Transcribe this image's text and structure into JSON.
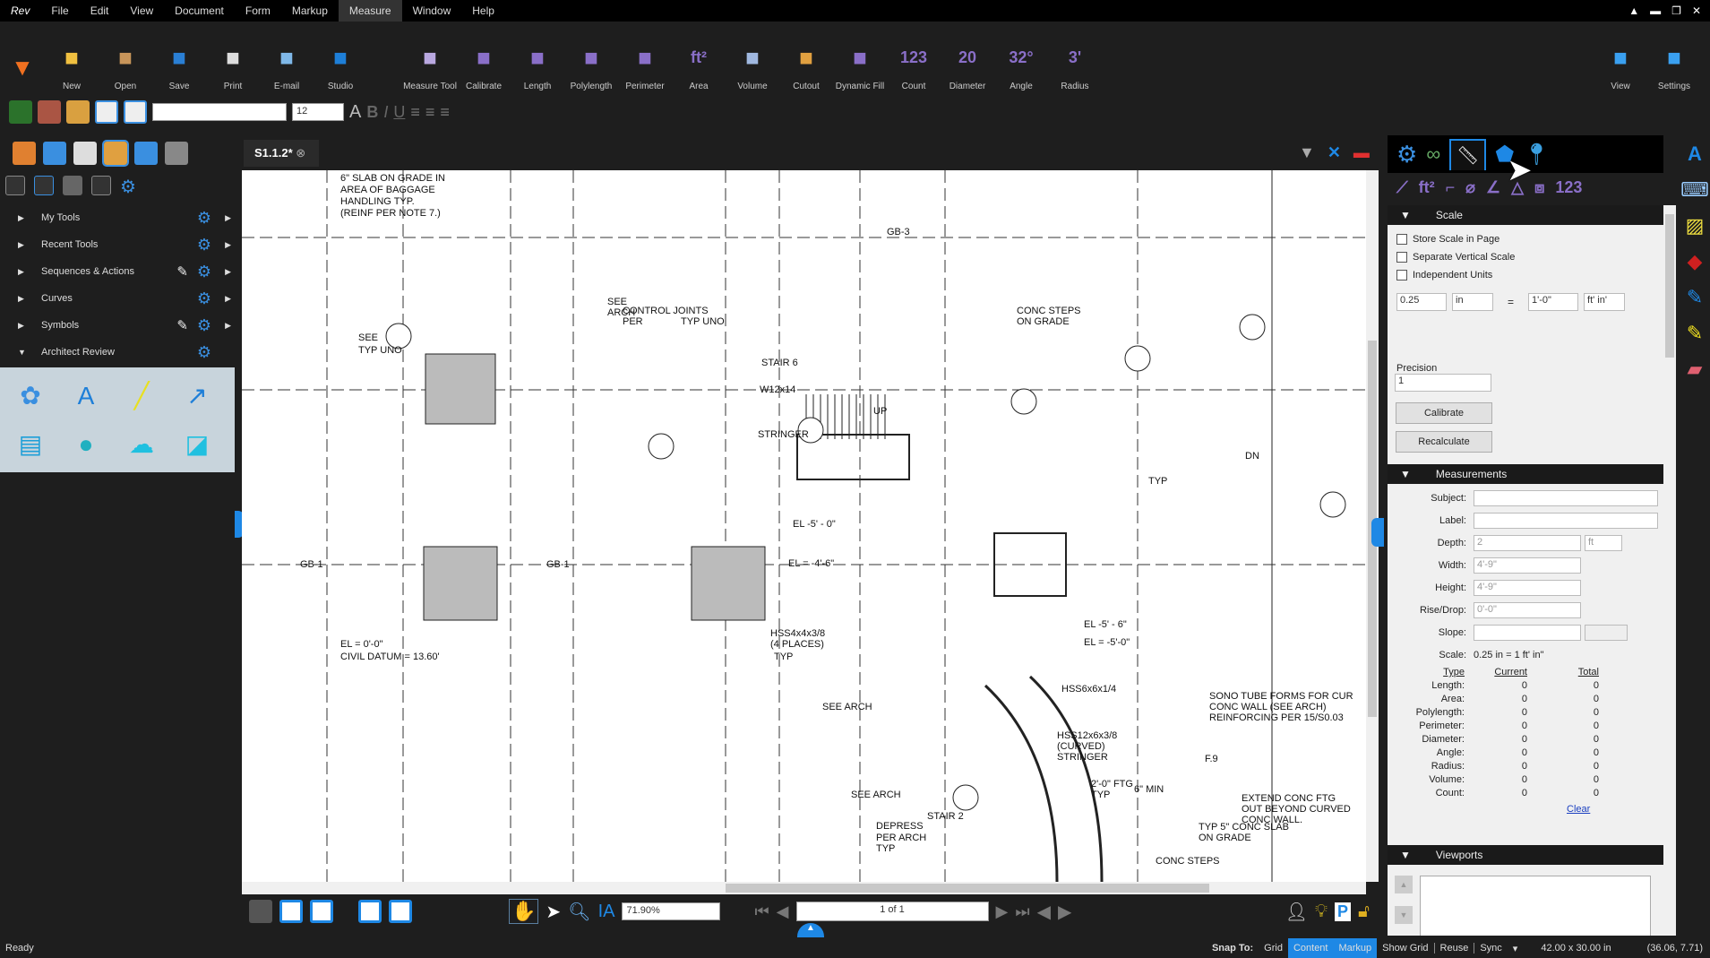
{
  "app": {
    "logo": "Rev",
    "window_controls": [
      "minimize",
      "restore",
      "close"
    ]
  },
  "menu": [
    "File",
    "Edit",
    "View",
    "Document",
    "Form",
    "Markup",
    "Measure",
    "Window",
    "Help"
  ],
  "menu_active": "Measure",
  "ribbon": [
    {
      "label": "New",
      "icon": "new-document-icon",
      "color": "#f0c040"
    },
    {
      "label": "Open",
      "icon": "open-folder-icon",
      "color": "#c8955a"
    },
    {
      "label": "Save",
      "icon": "save-disk-icon",
      "color": "#2a7fd4"
    },
    {
      "label": "Print",
      "icon": "printer-icon",
      "color": "#ddd"
    },
    {
      "label": "E-mail",
      "icon": "email-icon",
      "color": "#7fb8e8"
    },
    {
      "label": "Studio",
      "icon": "studio-icon",
      "color": "#1e7fd8"
    },
    {
      "label": "Measure Tool",
      "icon": "ruler-icon",
      "color": "#b9a8e0"
    },
    {
      "label": "Calibrate",
      "icon": "calibrate-icon",
      "color": "#8a6fc8"
    },
    {
      "label": "Length",
      "icon": "length-icon",
      "color": "#8a6fc8"
    },
    {
      "label": "Polylength",
      "icon": "polylength-icon",
      "color": "#8a6fc8"
    },
    {
      "label": "Perimeter",
      "icon": "perimeter-icon",
      "color": "#8a6fc8"
    },
    {
      "label": "Area",
      "icon": "area-icon",
      "glyph": "ft²",
      "color": "#8a6fc8"
    },
    {
      "label": "Volume",
      "icon": "volume-cube-icon",
      "color": "#a0b8e0"
    },
    {
      "label": "Cutout",
      "icon": "cutout-icon",
      "color": "#e0a040"
    },
    {
      "label": "Dynamic Fill",
      "icon": "dynamic-fill-icon",
      "color": "#8a6fc8"
    },
    {
      "label": "Count",
      "icon": "count-icon",
      "glyph": "123",
      "color": "#8a6fc8"
    },
    {
      "label": "Diameter",
      "icon": "diameter-icon",
      "glyph": "20",
      "color": "#8a6fc8"
    },
    {
      "label": "Angle",
      "icon": "angle-icon",
      "glyph": "32°",
      "color": "#8a6fc8"
    },
    {
      "label": "Radius",
      "icon": "radius-icon",
      "glyph": "3'",
      "color": "#8a6fc8"
    }
  ],
  "ribbon_right": [
    {
      "label": "View",
      "icon": "monitor-icon"
    },
    {
      "label": "Settings",
      "icon": "settings-logo-icon"
    }
  ],
  "format_toolbar": {
    "font_value": "",
    "size_value": "12"
  },
  "left_panel": {
    "items": [
      {
        "label": "My Tools",
        "expanded": false,
        "edit": false
      },
      {
        "label": "Recent Tools",
        "expanded": false,
        "edit": false
      },
      {
        "label": "Sequences & Actions",
        "expanded": false,
        "edit": true
      },
      {
        "label": "Curves",
        "expanded": false,
        "edit": false
      },
      {
        "label": "Symbols",
        "expanded": false,
        "edit": true
      },
      {
        "label": "Architect Review",
        "expanded": true,
        "edit": false
      }
    ]
  },
  "document_tab": {
    "label": "S1.1.2*"
  },
  "drawing_labels": [
    "6\" SLAB ON GRADE IN",
    "AREA OF BAGGAGE",
    "HANDLING TYP.",
    "(REINF PER NOTE 7.)",
    "CONTROL JOINTS",
    "PER",
    "TYP UNO",
    "SEE",
    "ARCH",
    "STAIR 6",
    "W12x14",
    "STRINGER",
    "CONC STEPS",
    "ON GRADE",
    "SEE",
    "TYP UNO",
    "EL -5' - 0\"",
    "EL = -4'-6\"",
    "GB-1",
    "GB-1",
    "EL = 0'-0\"",
    "CIVIL DATUM = 13.60'",
    "HSS4x4x3/8",
    "(4 PLACES)",
    "TYP",
    "SEE ARCH",
    "HSS6x6x1/4",
    "HSS12x6x3/8",
    "(CURVED)",
    "STRINGER",
    "2'-0\" FTG",
    "TYP",
    "SONO TUBE FORMS  FOR CUR",
    "CONC WALL (SEE ARCH)",
    "REINFORCING PER 15/S0.03",
    "F.9",
    "6\" MIN",
    "EXTEND CONC FTG",
    "OUT BEYOND CURVED",
    "CONC WALL.",
    "TYP 5\" CONC SLAB",
    "ON GRADE",
    "STAIR 2",
    "DEPRESS",
    "PER ARCH",
    "TYP",
    "SEE ARCH",
    "EL -5' - 6\"",
    "EL = -5'-0\"",
    "DN",
    "UP",
    "GB-3",
    "TYP",
    "CONC STEPS"
  ],
  "bottom_toolbar": {
    "zoom": "71.90%",
    "page": "1 of 1"
  },
  "right_panel": {
    "scale_header": "Scale",
    "checkboxes": [
      {
        "label": "Store Scale in Page",
        "checked": false
      },
      {
        "label": "Separate Vertical Scale",
        "checked": false
      },
      {
        "label": "Independent Units",
        "checked": false
      }
    ],
    "scale": {
      "value1": "0.25",
      "unit1": "in",
      "equals": "=",
      "value2": "1'-0\"",
      "unit2": "ft' in'"
    },
    "precision_label": "Precision",
    "precision_value": "1",
    "calibrate": "Calibrate",
    "recalculate": "Recalculate",
    "measurements_header": "Measurements",
    "fields": [
      {
        "label": "Subject:",
        "value": ""
      },
      {
        "label": "Label:",
        "value": ""
      },
      {
        "label": "Depth:",
        "value": "2",
        "unit": "ft"
      },
      {
        "label": "Width:",
        "value": "4'-9\""
      },
      {
        "label": "Height:",
        "value": "4'-9\""
      },
      {
        "label": "Rise/Drop:",
        "value": "0'-0\""
      },
      {
        "label": "Slope:",
        "value": ""
      }
    ],
    "scale_label": "Scale:",
    "scale_text": "0.25 in = 1 ft' in\"",
    "table_headers": [
      "Type",
      "Current",
      "Total"
    ],
    "table_rows": [
      [
        "Length:",
        "0",
        "0"
      ],
      [
        "Area:",
        "0",
        "0"
      ],
      [
        "Polylength:",
        "0",
        "0"
      ],
      [
        "Perimeter:",
        "0",
        "0"
      ],
      [
        "Diameter:",
        "0",
        "0"
      ],
      [
        "Angle:",
        "0",
        "0"
      ],
      [
        "Radius:",
        "0",
        "0"
      ],
      [
        "Volume:",
        "0",
        "0"
      ],
      [
        "Count:",
        "0",
        "0"
      ]
    ],
    "clear": "Clear",
    "viewports_header": "Viewports"
  },
  "status": {
    "ready": "Ready",
    "snap_to": "Snap To:",
    "grid": "Grid",
    "content": "Content",
    "markup": "Markup",
    "show_grid": "Show Grid",
    "reuse": "Reuse",
    "sync": "Sync",
    "page_size": "42.00 x 30.00 in",
    "coords": "(36.06, 7.71)"
  },
  "colors": {
    "accent": "#1e88e5",
    "measure_purple": "#8a6fc8",
    "panel_bg": "#f0f0f0",
    "dark_bg": "#1e1e1e"
  }
}
